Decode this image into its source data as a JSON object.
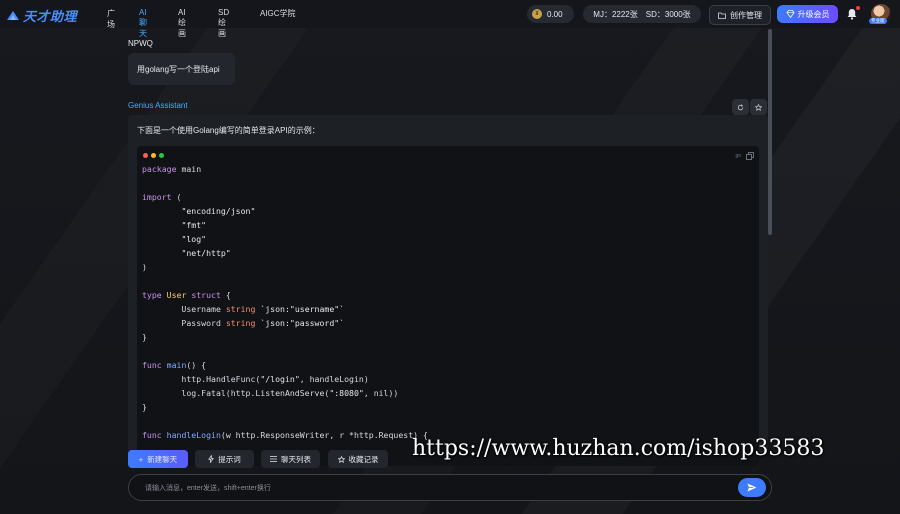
{
  "app": {
    "title": "天才助理"
  },
  "nav": {
    "items": [
      {
        "label": "广场"
      },
      {
        "label": "AI聊天"
      },
      {
        "label": "AI绘画"
      },
      {
        "label": "SD绘画"
      },
      {
        "label": "AIGC学院"
      }
    ],
    "active_color": "#4aa8ff"
  },
  "account": {
    "balance": "0.00",
    "mj_quota": "MJ：2222张",
    "sd_quota": "SD：3000张",
    "manage_label": "创作管理",
    "vip_label": "升级会员",
    "avatar_badge": "专业版"
  },
  "chat": {
    "user_name": "NPWQ",
    "user_message": "用golang写一个登陆api",
    "assistant_name": "Genius Assistant",
    "assistant_intro": "下面是一个使用Golang编写的简单登录API的示例：",
    "code_lang": "go",
    "code_lines": [
      "package main",
      "",
      "import (",
      "        \"encoding/json\"",
      "        \"fmt\"",
      "        \"log\"",
      "        \"net/http\"",
      ")",
      "",
      "type User struct {",
      "        Username string `json:\"username\"`",
      "        Password string `json:\"password\"`",
      "}",
      "",
      "func main() {",
      "        http.HandleFunc(\"/login\", handleLogin)",
      "        log.Fatal(http.ListenAndServe(\":8080\", nil))",
      "}",
      "",
      "func handleLogin(w http.ResponseWriter, r *http.Request) {"
    ]
  },
  "toolbar": {
    "new_chat": "新建聊天",
    "prompts": "提示词",
    "chat_list": "聊天列表",
    "favorites": "收藏记录"
  },
  "input": {
    "placeholder": "请输入消息，enter发送，shift+enter换行"
  },
  "watermark": "https://www.huzhan.com/ishop33583",
  "colors": {
    "brand": "#3d7bff",
    "accent_cyan": "#3fb0ff"
  }
}
